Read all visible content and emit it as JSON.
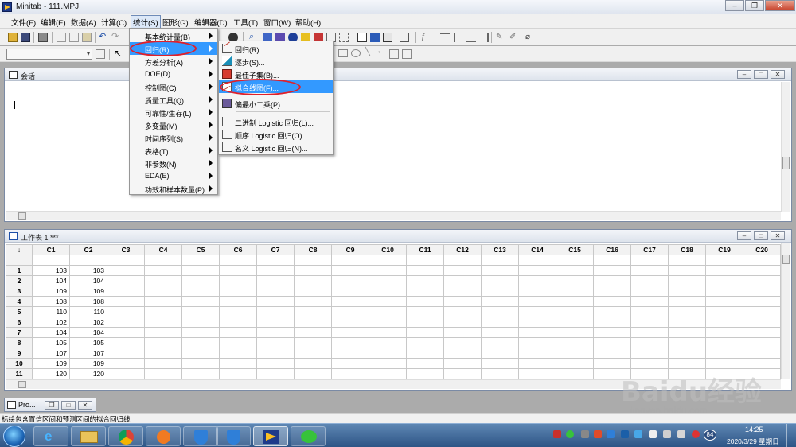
{
  "window": {
    "title": "Minitab - 111.MPJ"
  },
  "menubar": [
    {
      "label": "文件(F)"
    },
    {
      "label": "编辑(E)"
    },
    {
      "label": "数据(A)"
    },
    {
      "label": "计算(C)"
    },
    {
      "label": "统计(S)"
    },
    {
      "label": "图形(G)"
    },
    {
      "label": "编辑器(D)"
    },
    {
      "label": "工具(T)"
    },
    {
      "label": "窗口(W)"
    },
    {
      "label": "帮助(H)"
    }
  ],
  "stat_menu": [
    {
      "label": "基本统计量(B)"
    },
    {
      "label": "回归(R)"
    },
    {
      "label": "方差分析(A)"
    },
    {
      "label": "DOE(D)"
    },
    {
      "label": "控制图(C)"
    },
    {
      "label": "质量工具(Q)"
    },
    {
      "label": "可靠性/生存(L)"
    },
    {
      "label": "多变量(M)"
    },
    {
      "label": "时间序列(S)"
    },
    {
      "label": "表格(T)"
    },
    {
      "label": "非参数(N)"
    },
    {
      "label": "EDA(E)"
    },
    {
      "label": "功效和样本数量(P)..."
    }
  ],
  "regression_menu": [
    {
      "label": "回归(R)..."
    },
    {
      "label": "逐步(S)..."
    },
    {
      "label": "最佳子集(B)..."
    },
    {
      "label": "拟合线图(F)..."
    },
    {
      "label": "偏最小二乘(P)..."
    },
    {
      "label": "二进制 Logistic 回归(L)..."
    },
    {
      "label": "顺序 Logistic 回归(O)..."
    },
    {
      "label": "名义 Logistic 回归(N)..."
    }
  ],
  "session": {
    "title": "会话"
  },
  "worksheet": {
    "title": "工作表 1 ***",
    "corner": "↓",
    "columns": [
      "C1",
      "C2",
      "C3",
      "C4",
      "C5",
      "C6",
      "C7",
      "C8",
      "C9",
      "C10",
      "C11",
      "C12",
      "C13",
      "C14",
      "C15",
      "C16",
      "C17",
      "C18",
      "C19",
      "C20"
    ],
    "rows": [
      {
        "n": "1",
        "c1": "103",
        "c2": "103"
      },
      {
        "n": "2",
        "c1": "104",
        "c2": "104"
      },
      {
        "n": "3",
        "c1": "109",
        "c2": "109"
      },
      {
        "n": "4",
        "c1": "108",
        "c2": "108"
      },
      {
        "n": "5",
        "c1": "110",
        "c2": "110"
      },
      {
        "n": "6",
        "c1": "102",
        "c2": "102"
      },
      {
        "n": "7",
        "c1": "104",
        "c2": "104"
      },
      {
        "n": "8",
        "c1": "105",
        "c2": "105"
      },
      {
        "n": "9",
        "c1": "107",
        "c2": "107"
      },
      {
        "n": "10",
        "c1": "109",
        "c2": "109"
      },
      {
        "n": "11",
        "c1": "120",
        "c2": "120"
      }
    ]
  },
  "project_tab": {
    "label": "Pro..."
  },
  "status": {
    "text": "标绘包含置信区间和预测区间的拟合回归线"
  },
  "watermark": {
    "main": "Baidu经验",
    "sub": "jingyan.baidu.com"
  },
  "clock": {
    "time": "14:25",
    "date": "2020/3/29 星期日",
    "badge": "84"
  },
  "colors": {
    "selection": "#3399ff",
    "highlight_ellipse": "#e0202a",
    "taskbar": "#2e5586"
  }
}
